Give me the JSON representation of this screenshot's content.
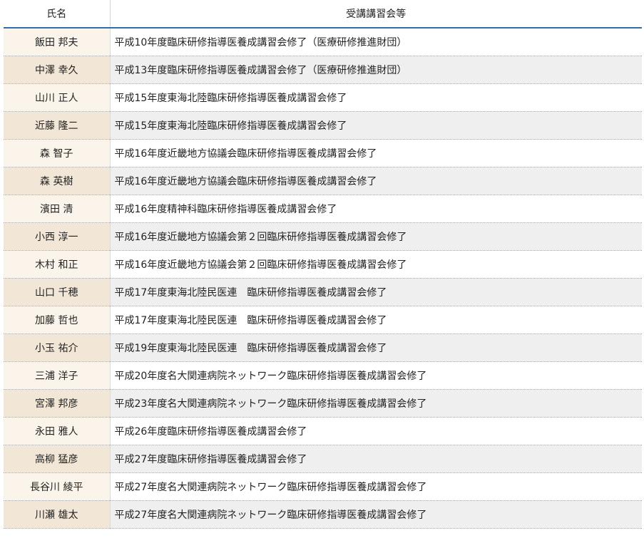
{
  "table": {
    "headers": {
      "name": "氏名",
      "course": "受講講習会等"
    },
    "rows": [
      {
        "name": "飯田 邦夫",
        "course": "平成10年度臨床研修指導医養成講習会修了（医療研修推進財団）"
      },
      {
        "name": "中澤 幸久",
        "course": "平成13年度臨床研修指導医養成講習会修了（医療研修推進財団）"
      },
      {
        "name": "山川 正人",
        "course": "平成15年度東海北陸臨床研修指導医養成講習会修了"
      },
      {
        "name": "近藤 隆二",
        "course": "平成15年度東海北陸臨床研修指導医養成講習会修了"
      },
      {
        "name": "森 智子",
        "course": "平成16年度近畿地方協議会臨床研修指導医養成講習会修了"
      },
      {
        "name": "森 英樹",
        "course": "平成16年度近畿地方協議会臨床研修指導医養成講習会修了"
      },
      {
        "name": "濱田 清",
        "course": "平成16年度精神科臨床研修指導医養成講習会修了"
      },
      {
        "name": "小西 淳一",
        "course": "平成16年度近畿地方協議会第２回臨床研修指導医養成講習会修了"
      },
      {
        "name": "木村 和正",
        "course": "平成16年度近畿地方協議会第２回臨床研修指導医養成講習会修了"
      },
      {
        "name": "山口 千穂",
        "course": "平成17年度東海北陸民医連　臨床研修指導医養成講習会修了"
      },
      {
        "name": "加藤 哲也",
        "course": "平成17年度東海北陸民医連　臨床研修指導医養成講習会修了"
      },
      {
        "name": "小玉 祐介",
        "course": "平成19年度東海北陸民医連　臨床研修指導医養成講習会修了"
      },
      {
        "name": "三浦 洋子",
        "course": "平成20年度名大関連病院ネットワーク臨床研修指導医養成講習会修了"
      },
      {
        "name": "宮澤 邦彦",
        "course": "平成23年度名大関連病院ネットワーク臨床研修指導医養成講習会修了"
      },
      {
        "name": "永田 雅人",
        "course": "平成26年度臨床研修指導医養成講習会修了"
      },
      {
        "name": "高柳 猛彦",
        "course": "平成27年度臨床研修指導医養成講習会修了"
      },
      {
        "name": "長谷川 綾平",
        "course": "平成27年度名大関連病院ネットワーク臨床研修指導医養成講習会修了"
      },
      {
        "name": "川瀬 雄太",
        "course": "平成27年度名大関連病院ネットワーク臨床研修指導医養成講習会修了"
      }
    ]
  }
}
